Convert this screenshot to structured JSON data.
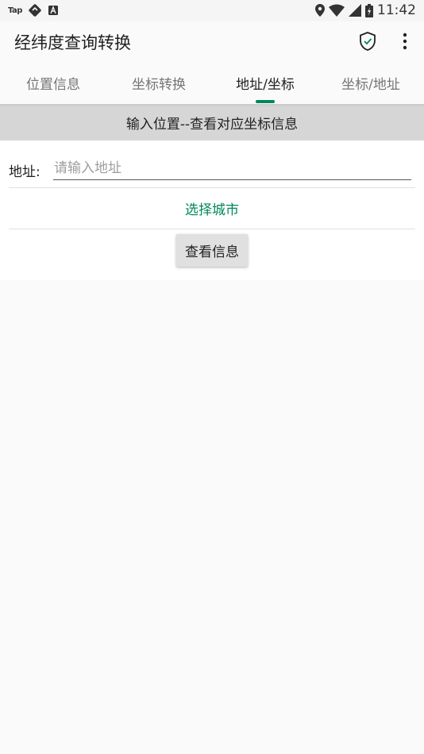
{
  "status_bar": {
    "left_text": "Tap",
    "time": "11:42",
    "icons": [
      "location-icon",
      "wifi-icon",
      "signal-icon",
      "battery-icon"
    ]
  },
  "app_bar": {
    "title": "经纬度查询转换",
    "shield_icon": "shield-check-icon",
    "more_icon": "more-vert-icon"
  },
  "tabs": [
    {
      "label": "位置信息",
      "active": false
    },
    {
      "label": "坐标转换",
      "active": false
    },
    {
      "label": "地址/坐标",
      "active": true
    },
    {
      "label": "坐标/地址",
      "active": false
    }
  ],
  "banner": {
    "text": "输入位置--查看对应坐标信息"
  },
  "form": {
    "address_label": "地址:",
    "address_value": "",
    "address_placeholder": "请输入地址",
    "select_city_label": "选择城市",
    "view_info_label": "查看信息"
  },
  "colors": {
    "accent": "#00875a",
    "banner_bg": "#d6d6d6",
    "page_bg": "#fafafa"
  }
}
